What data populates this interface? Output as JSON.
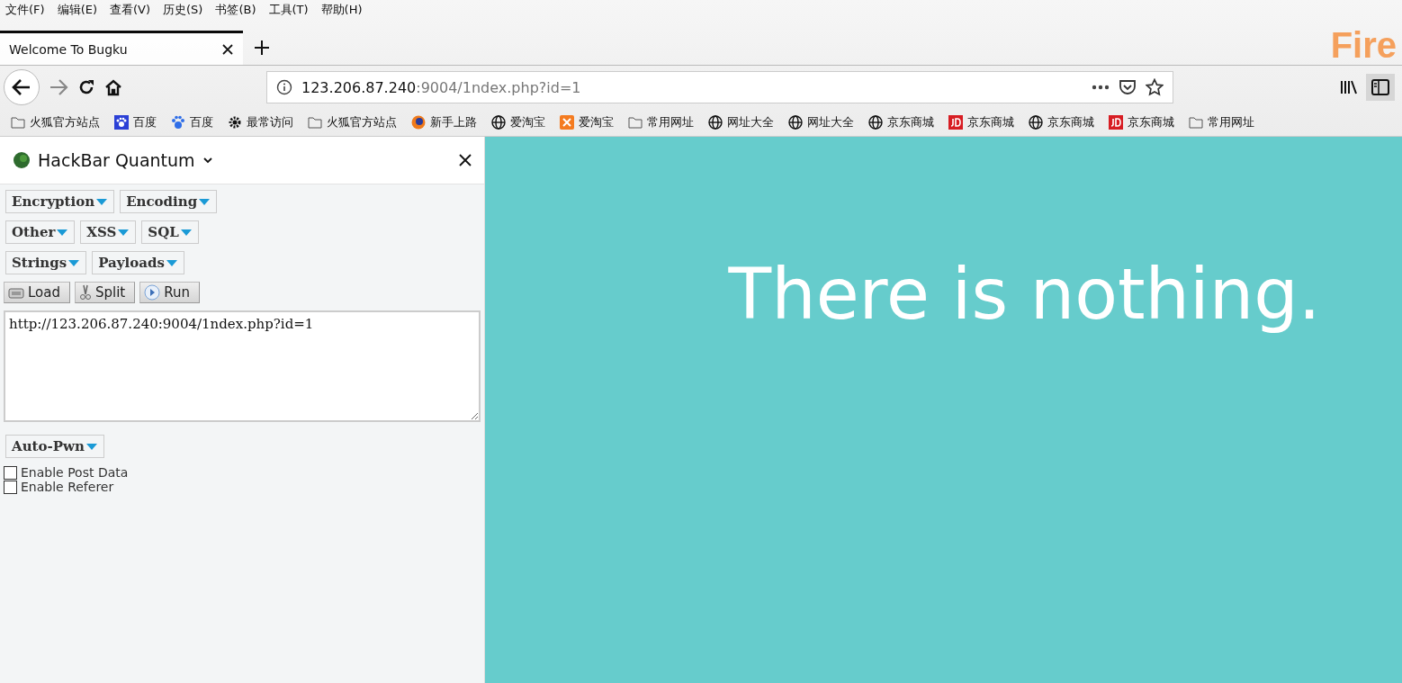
{
  "menu_bar": [
    "文件(F)",
    "编辑(E)",
    "查看(V)",
    "历史(S)",
    "书签(B)",
    "工具(T)",
    "帮助(H)"
  ],
  "tabs": [
    {
      "title": "Welcome To Bugku",
      "selected": true
    }
  ],
  "theme_logo": "Fire",
  "address_bar": {
    "host": "123.206.87.240",
    "path": ":9004/1ndex.php?id=1"
  },
  "bookmarks": [
    {
      "label": "火狐官方站点",
      "kind": "folder"
    },
    {
      "label": "百度",
      "kind": "paw"
    },
    {
      "label": "百度",
      "kind": "baidu"
    },
    {
      "label": "最常访问",
      "kind": "gear"
    },
    {
      "label": "火狐官方站点",
      "kind": "folder"
    },
    {
      "label": "新手上路",
      "kind": "firefox"
    },
    {
      "label": "爱淘宝",
      "kind": "globe"
    },
    {
      "label": "爱淘宝",
      "kind": "orange"
    },
    {
      "label": "常用网址",
      "kind": "folder"
    },
    {
      "label": "网址大全",
      "kind": "globe"
    },
    {
      "label": "网址大全",
      "kind": "globe"
    },
    {
      "label": "京东商城",
      "kind": "globe"
    },
    {
      "label": "京东商城",
      "kind": "jd"
    },
    {
      "label": "京东商城",
      "kind": "globe"
    },
    {
      "label": "京东商城",
      "kind": "jd"
    },
    {
      "label": "常用网址",
      "kind": "folder"
    }
  ],
  "sidebar": {
    "title": "HackBar Quantum",
    "menu_rows": [
      [
        "Encryption",
        "Encoding"
      ],
      [
        "Other",
        "XSS",
        "SQL"
      ],
      [
        "Strings",
        "Payloads"
      ]
    ],
    "actions": [
      {
        "label": "Load",
        "kind": "load"
      },
      {
        "label": "Split",
        "kind": "split"
      },
      {
        "label": "Run",
        "kind": "run"
      }
    ],
    "url_value": "http://123.206.87.240:9004/1ndex.php?id=1",
    "auto_pwn": "Auto-Pwn",
    "options": [
      {
        "label": "Enable Post Data",
        "checked": false
      },
      {
        "label": "Enable Referer",
        "checked": false
      }
    ]
  },
  "page": {
    "message": "There is nothing."
  }
}
